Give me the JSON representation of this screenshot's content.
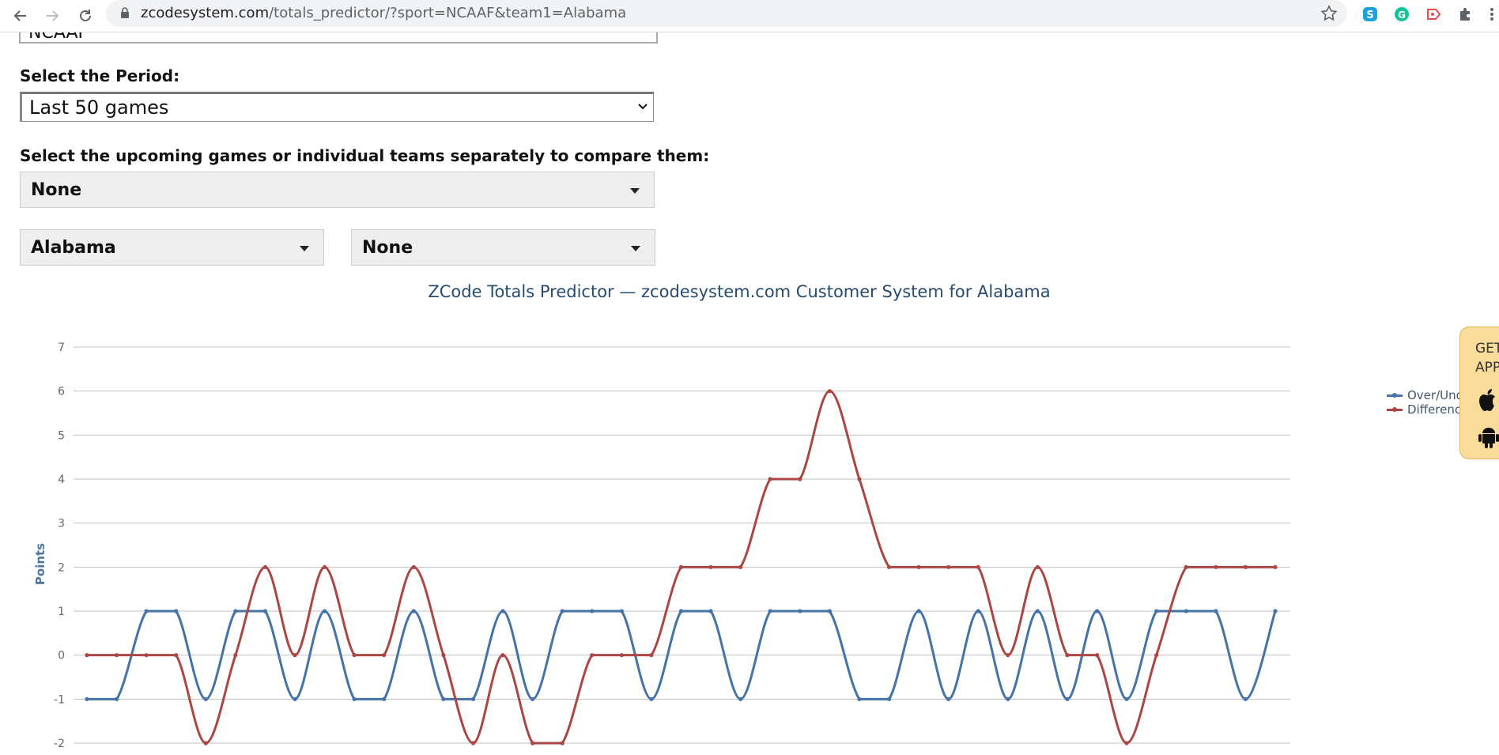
{
  "browser": {
    "url_host": "zcodesystem.com",
    "url_path": "/totals_predictor/?sport=NCAAF&team1=Alabama"
  },
  "form": {
    "sport_value": "NCAAF",
    "period_label": "Select the Period:",
    "period_value": "Last 50 games",
    "compare_label": "Select the upcoming games or individual teams separately to compare them:",
    "game_select_value": "None",
    "team1_value": "Alabama",
    "team2_value": "None"
  },
  "get_app": {
    "line1": "GET",
    "line2": "APPS"
  },
  "colors": {
    "blue": "#4572a7",
    "red": "#aa4643",
    "grid": "#c0c0c0"
  },
  "chart_data": {
    "type": "line",
    "title": "ZCode Totals Predictor — zcodesystem.com Customer System for Alabama",
    "ylabel": "Points",
    "xlabel": "",
    "ylim": [
      -2,
      7
    ],
    "yticks": [
      -2,
      -1,
      0,
      1,
      2,
      3,
      4,
      5,
      6,
      7
    ],
    "grid": true,
    "legend_position": "right",
    "series": [
      {
        "name": "Over/Under",
        "color": "#4572a7",
        "values": [
          -1,
          -1,
          1,
          1,
          -1,
          1,
          1,
          -1,
          1,
          -1,
          -1,
          1,
          -1,
          -1,
          1,
          -1,
          1,
          1,
          1,
          -1,
          1,
          1,
          -1,
          1,
          1,
          1,
          -1,
          -1,
          1,
          -1,
          1,
          -1,
          1,
          -1,
          1,
          -1,
          1,
          1,
          1,
          -1,
          1
        ]
      },
      {
        "name": "Difference",
        "color": "#aa4643",
        "values": [
          0,
          0,
          0,
          0,
          -2,
          0,
          2,
          0,
          2,
          0,
          0,
          2,
          0,
          -2,
          0,
          -2,
          -2,
          0,
          0,
          0,
          2,
          2,
          2,
          4,
          4,
          6,
          4,
          2,
          2,
          2,
          2,
          0,
          2,
          0,
          0,
          -2,
          0,
          2,
          2,
          2,
          2
        ]
      }
    ]
  }
}
